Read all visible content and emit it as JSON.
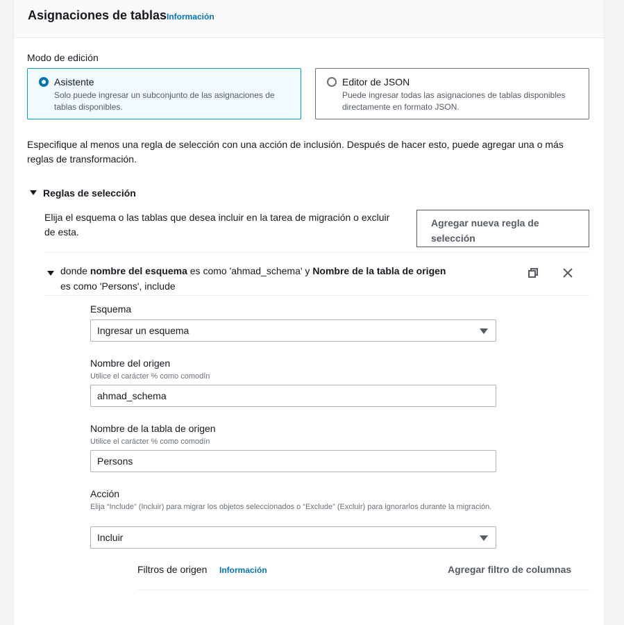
{
  "panel": {
    "title": "Asignaciones de tablas",
    "info_link": "Información"
  },
  "edit_mode": {
    "label": "Modo de edición",
    "options": [
      {
        "title": "Asistente",
        "description": "Solo puede ingresar un subconjunto de las asignaciones de tablas disponibles.",
        "selected": true
      },
      {
        "title": "Editor de JSON",
        "description": "Puede ingresar todas las asignaciones de tablas disponibles directamente en formato JSON.",
        "selected": false
      }
    ]
  },
  "intro_text": "Especifique al menos una regla de selección con una acción de inclusión. Después de hacer esto, puede agregar una o más reglas de transformación.",
  "selection_rules": {
    "heading": "Reglas de selección",
    "description": "Elija el esquema o las tablas que desea incluir en la tarea de migración o excluir de esta.",
    "add_button": "Agregar nueva regla de selección",
    "rule": {
      "summary_parts": [
        "donde ",
        "nombre del esquema",
        " es como 'ahmad_schema' y ",
        "Nombre de la tabla de origen",
        " es como 'Persons', include"
      ],
      "copy_icon": "copy-icon",
      "close_icon": "close-icon",
      "schema": {
        "label": "Esquema",
        "value": "Ingresar un esquema"
      },
      "source_name": {
        "label": "Nombre del origen",
        "description": "Utilice el carácter % como comodín",
        "value": "ahmad_schema"
      },
      "source_table": {
        "label": "Nombre de la tabla de origen",
        "description": "Utilice el carácter % como comodín",
        "value": "Persons"
      },
      "action": {
        "label": "Acción",
        "description": "Elija “Include” (Incluir) para migrar los objetos seleccionados o “Exclude” (Excluir) para ignorarlos durante la migración.",
        "value": "Incluir"
      },
      "source_filters": {
        "label": "Filtros de origen",
        "info_link": "Información",
        "add_button": "Agregar filtro de columnas"
      }
    }
  },
  "colors": {
    "accent": "#0073bb",
    "selected_bg": "#f1faff",
    "selected_border": "#00a1c9"
  }
}
